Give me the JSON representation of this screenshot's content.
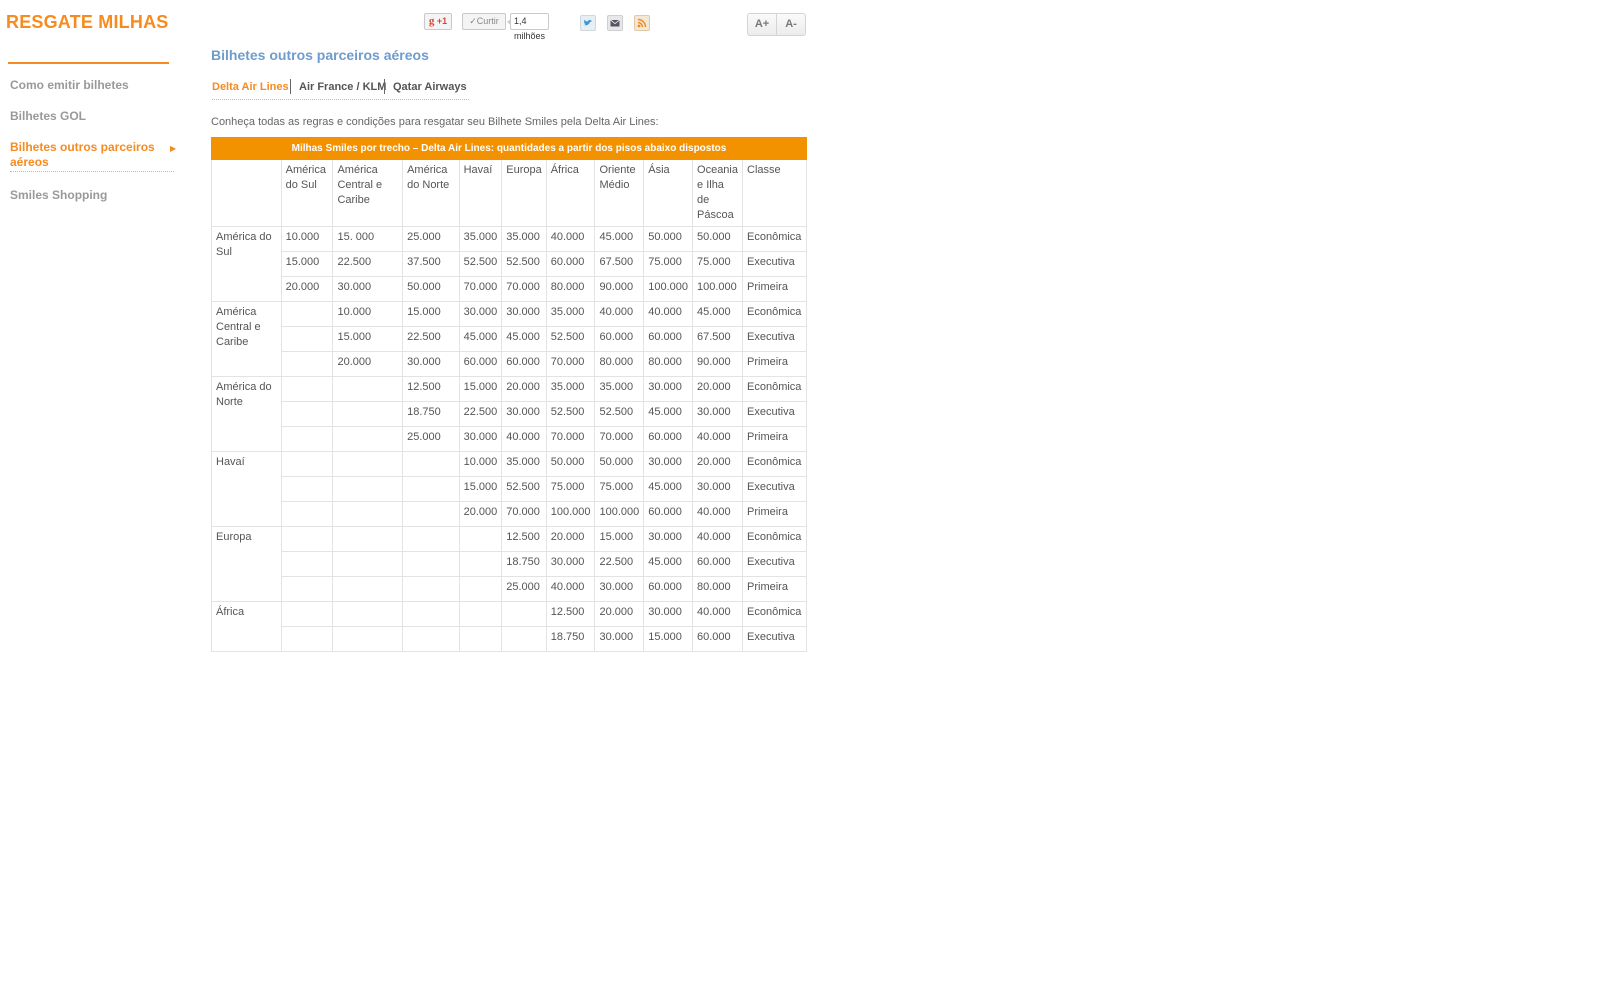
{
  "header": {
    "section_title": "RESGATE MILHAS",
    "social": {
      "gplus_label": "+1",
      "like_label": "Curtir",
      "like_count": "1,4 milhões",
      "icons": [
        "twitter-icon",
        "mail-icon",
        "rss-icon"
      ]
    },
    "font_increase": "A+",
    "font_decrease": "A-"
  },
  "sidebar": {
    "items": [
      {
        "label": "Como emitir bilhetes"
      },
      {
        "label": "Bilhetes GOL"
      },
      {
        "label": "Bilhetes outros parceiros aéreos"
      },
      {
        "label": "Smiles Shopping"
      }
    ]
  },
  "main": {
    "title": "Bilhetes outros parceiros aéreos",
    "tabs": [
      {
        "label": "Delta Air Lines"
      },
      {
        "label": "Air France / KLM"
      },
      {
        "label": "Qatar Airways"
      }
    ],
    "intro": "Conheça todas as regras e condições para resgatar seu Bilhete Smiles pela Delta Air Lines:",
    "table": {
      "banner": "Milhas Smiles por trecho – Delta Air Lines: quantidades a partir dos pisos abaixo dispostos",
      "headers": [
        "",
        "América do Sul",
        "América Central e Caribe",
        "América do Norte",
        "Havaí",
        "Europa",
        "África",
        "Oriente Médio",
        "Ásia",
        "Oceania e Ilha de Páscoa",
        "Classe"
      ],
      "groups": [
        {
          "region": "América do Sul",
          "rows": [
            [
              "10.000",
              "15. 000",
              "25.000",
              "35.000",
              "35.000",
              "40.000",
              "45.000",
              "50.000",
              "50.000",
              "Econômica"
            ],
            [
              "15.000",
              "22.500",
              "37.500",
              "52.500",
              "52.500",
              "60.000",
              "67.500",
              "75.000",
              "75.000",
              "Executiva"
            ],
            [
              "20.000",
              "30.000",
              "50.000",
              "70.000",
              "70.000",
              "80.000",
              "90.000",
              "100.000",
              "100.000",
              "Primeira"
            ]
          ]
        },
        {
          "region": "América Central e Caribe",
          "rows": [
            [
              "",
              "10.000",
              "15.000",
              "30.000",
              "30.000",
              "35.000",
              "40.000",
              "40.000",
              "45.000",
              "Econômica"
            ],
            [
              "",
              "15.000",
              "22.500",
              "45.000",
              "45.000",
              "52.500",
              "60.000",
              "60.000",
              "67.500",
              "Executiva"
            ],
            [
              "",
              "20.000",
              "30.000",
              "60.000",
              "60.000",
              "70.000",
              "80.000",
              "80.000",
              "90.000",
              "Primeira"
            ]
          ]
        },
        {
          "region": "América do Norte",
          "rows": [
            [
              "",
              "",
              "12.500",
              "15.000",
              "20.000",
              "35.000",
              "35.000",
              "30.000",
              "20.000",
              "Econômica"
            ],
            [
              "",
              "",
              "18.750",
              "22.500",
              "30.000",
              "52.500",
              "52.500",
              "45.000",
              "30.000",
              "Executiva"
            ],
            [
              "",
              "",
              "25.000",
              "30.000",
              "40.000",
              "70.000",
              "70.000",
              "60.000",
              "40.000",
              "Primeira"
            ]
          ]
        },
        {
          "region": "Havaí",
          "rows": [
            [
              "",
              "",
              "",
              "10.000",
              "35.000",
              "50.000",
              "50.000",
              "30.000",
              "20.000",
              "Econômica"
            ],
            [
              "",
              "",
              "",
              "15.000",
              "52.500",
              "75.000",
              "75.000",
              "45.000",
              "30.000",
              "Executiva"
            ],
            [
              "",
              "",
              "",
              "20.000",
              "70.000",
              "100.000",
              "100.000",
              "60.000",
              "40.000",
              "Primeira"
            ]
          ]
        },
        {
          "region": "Europa",
          "rows": [
            [
              "",
              "",
              "",
              "",
              "12.500",
              "20.000",
              "15.000",
              "30.000",
              "40.000",
              "Econômica"
            ],
            [
              "",
              "",
              "",
              "",
              "18.750",
              "30.000",
              "22.500",
              "45.000",
              "60.000",
              "Executiva"
            ],
            [
              "",
              "",
              "",
              "",
              "25.000",
              "40.000",
              "30.000",
              "60.000",
              "80.000",
              "Primeira"
            ]
          ]
        },
        {
          "region": "África",
          "rows": [
            [
              "",
              "",
              "",
              "",
              "",
              "12.500",
              "20.000",
              "30.000",
              "40.000",
              "Econômica"
            ],
            [
              "",
              "",
              "",
              "",
              "",
              "18.750",
              "30.000",
              "15.000",
              "60.000",
              "Executiva"
            ]
          ]
        }
      ]
    }
  }
}
